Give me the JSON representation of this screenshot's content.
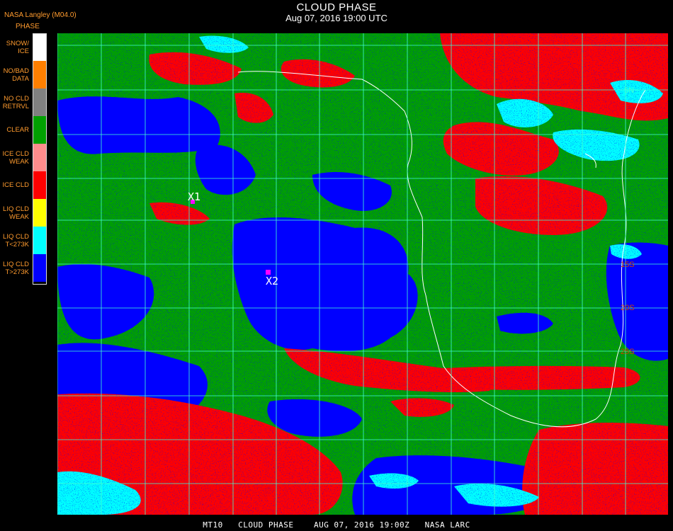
{
  "title": "CLOUD PHASE",
  "date_line": "Aug 07, 2016 19:00 UTC",
  "product": "NASA Langley (M04.0)",
  "legend_heading": "PHASE",
  "legend": [
    {
      "label": "SNOW/\nICE",
      "color": "#ffffff"
    },
    {
      "label": "NO/BAD\nDATA",
      "color": "#ff7f00"
    },
    {
      "label": "NO CLD\nRETRVL",
      "color": "#808080"
    },
    {
      "label": "CLEAR",
      "color": "#00a000"
    },
    {
      "label": "ICE CLD\nWEAK",
      "color": "#ff8c8c"
    },
    {
      "label": "ICE CLD",
      "color": "#ff0000"
    },
    {
      "label": "LIQ CLD\nWEAK",
      "color": "#ffff00"
    },
    {
      "label": "LIQ CLD\nT<273K",
      "color": "#00ffff"
    },
    {
      "label": "LIQ CLD\nT>273K",
      "color": "#0000ff"
    }
  ],
  "markers": [
    {
      "label": "X1",
      "color": "#ff00ff"
    },
    {
      "label": "X2",
      "color": "#ff00ff"
    }
  ],
  "grid_labels": [
    "5N",
    "15S",
    "20S",
    "25S"
  ],
  "footer": "MT10   CLOUD PHASE    AUG 07, 2016 19:00Z   NASA LARC",
  "colors": {
    "grid": "#40ffd0",
    "coast": "#ffffff",
    "grid_label": "#cc4400"
  }
}
